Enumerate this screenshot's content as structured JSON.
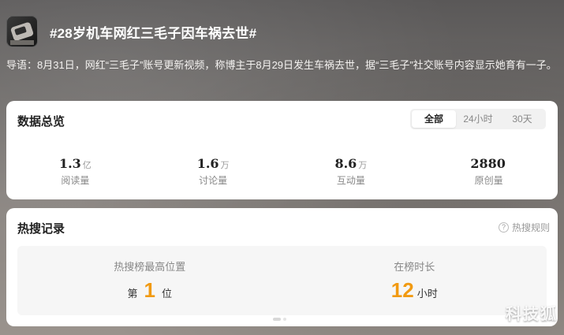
{
  "header": {
    "title": "#28岁机车网红三毛子因车祸去世#",
    "thumbnail_icon": "topic-thumbnail"
  },
  "intro": "导语：8月31日，网红“三毛子”账号更新视频，称博主于8月29日发生车祸去世，据“三毛子”社交账号内容显示她育有一子。",
  "overview": {
    "title": "数据总览",
    "tabs": [
      {
        "label": "全部",
        "active": true
      },
      {
        "label": "24小时",
        "active": false
      },
      {
        "label": "30天",
        "active": false
      }
    ],
    "stats": [
      {
        "value": "1.3",
        "unit": "亿",
        "label": "阅读量"
      },
      {
        "value": "1.6",
        "unit": "万",
        "label": "讨论量"
      },
      {
        "value": "8.6",
        "unit": "万",
        "label": "互动量"
      },
      {
        "value": "2880",
        "unit": "",
        "label": "原创量"
      }
    ]
  },
  "hot_record": {
    "title": "热搜记录",
    "rules_label": "热搜规则",
    "rules_icon": "question-circle-icon",
    "peak": {
      "label": "热搜榜最高位置",
      "prefix": "第",
      "value": "1",
      "suffix": "位"
    },
    "duration": {
      "label": "在榜时长",
      "value": "12",
      "suffix": "小时"
    }
  },
  "watermark": "科技狐",
  "colors": {
    "accent": "#f19a12"
  }
}
